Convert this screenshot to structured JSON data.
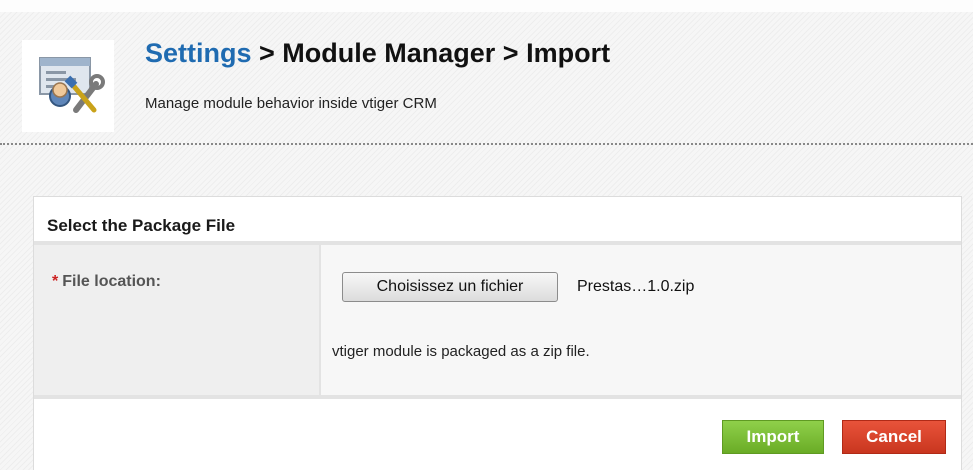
{
  "header": {
    "icon": "settings-tools-icon",
    "breadcrumb_settings": "Settings",
    "breadcrumb_rest": " > Module Manager > Import",
    "subtitle": "Manage module behavior inside vtiger CRM"
  },
  "panel": {
    "title": "Select the Package File",
    "required_marker": "*",
    "field_label": "File location:",
    "file_button_label": "Choisissez un fichier",
    "file_name": "Prestas…1.0.zip",
    "help_text": "vtiger module is packaged as a zip file."
  },
  "actions": {
    "import_label": "Import",
    "cancel_label": "Cancel"
  },
  "colors": {
    "link": "#1f6bb1",
    "import": "#7bbd36",
    "cancel": "#d8442c",
    "required": "#cc2222"
  }
}
